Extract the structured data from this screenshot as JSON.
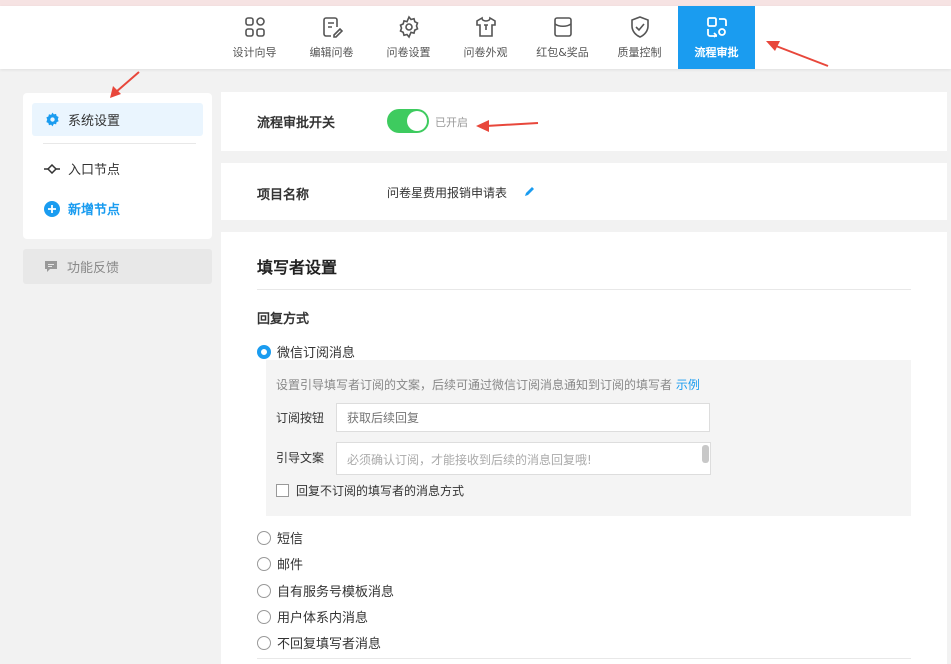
{
  "tabs": [
    {
      "label": "设计向导",
      "icon": "grid-icon"
    },
    {
      "label": "编辑问卷",
      "icon": "edit-doc-icon"
    },
    {
      "label": "问卷设置",
      "icon": "gear-icon"
    },
    {
      "label": "问卷外观",
      "icon": "shirt-icon"
    },
    {
      "label": "红包&奖品",
      "icon": "envelope-icon"
    },
    {
      "label": "质量控制",
      "icon": "shield-check-icon"
    },
    {
      "label": "流程审批",
      "icon": "workflow-icon"
    }
  ],
  "active_tab": "流程审批",
  "sidebar": {
    "items": [
      {
        "label": "系统设置",
        "icon": "gear-icon"
      },
      {
        "label": "入口节点",
        "icon": "node-icon"
      },
      {
        "label": "新增节点",
        "icon": "plus-circle-icon"
      }
    ],
    "feedback": {
      "label": "功能反馈",
      "icon": "chat-icon"
    }
  },
  "approval": {
    "label": "流程审批开关",
    "status": "已开启",
    "enabled": true
  },
  "project": {
    "label": "项目名称",
    "value": "问卷星费用报销申请表"
  },
  "filler": {
    "title": "填写者设置",
    "reply_label": "回复方式",
    "options": [
      "微信订阅消息",
      "短信",
      "邮件",
      "自有服务号模板消息",
      "用户体系内消息",
      "不回复填写者消息"
    ],
    "selected": "微信订阅消息",
    "wechat": {
      "desc": "设置引导填写者订阅的文案，后续可通过微信订阅消息通知到订阅的填写者",
      "example_link": "示例",
      "button_label": "订阅按钮",
      "button_placeholder": "获取后续回复",
      "guide_label": "引导文案",
      "guide_placeholder": "必须确认订阅，才能接收到后续的消息回复哦!",
      "checkbox_label": "回复不订阅的填写者的消息方式"
    }
  },
  "colors": {
    "accent": "#1a9cf0",
    "toggle_on": "#3ecb5f",
    "annotation_arrow": "#e8473b"
  }
}
